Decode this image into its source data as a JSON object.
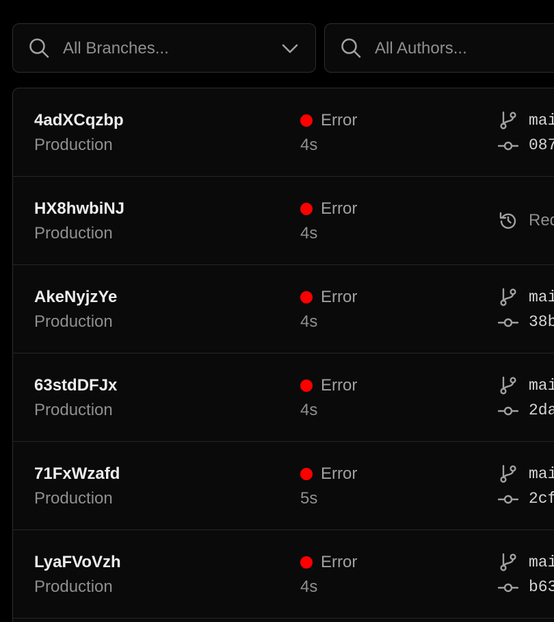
{
  "filters": {
    "branches_placeholder": "All Branches...",
    "authors_placeholder": "All Authors..."
  },
  "colors": {
    "error": "#ff0000",
    "background": "#000000",
    "panel": "#0a0a0a"
  },
  "deployments": [
    {
      "id": "4adXCqzbp",
      "environment": "Production",
      "status": "Error",
      "duration": "4s",
      "branch": "mai",
      "commit": "087"
    },
    {
      "id": "HX8hwbiNJ",
      "environment": "Production",
      "status": "Error",
      "duration": "4s",
      "redeploy_label": "Red"
    },
    {
      "id": "AkeNyjzYe",
      "environment": "Production",
      "status": "Error",
      "duration": "4s",
      "branch": "mai",
      "commit": "38b"
    },
    {
      "id": "63stdDFJx",
      "environment": "Production",
      "status": "Error",
      "duration": "4s",
      "branch": "mai",
      "commit": "2da"
    },
    {
      "id": "71FxWzafd",
      "environment": "Production",
      "status": "Error",
      "duration": "5s",
      "branch": "mai",
      "commit": "2cf"
    },
    {
      "id": "LyaFVoVzh",
      "environment": "Production",
      "status": "Error",
      "duration": "4s",
      "branch": "mai",
      "commit": "b63"
    }
  ]
}
